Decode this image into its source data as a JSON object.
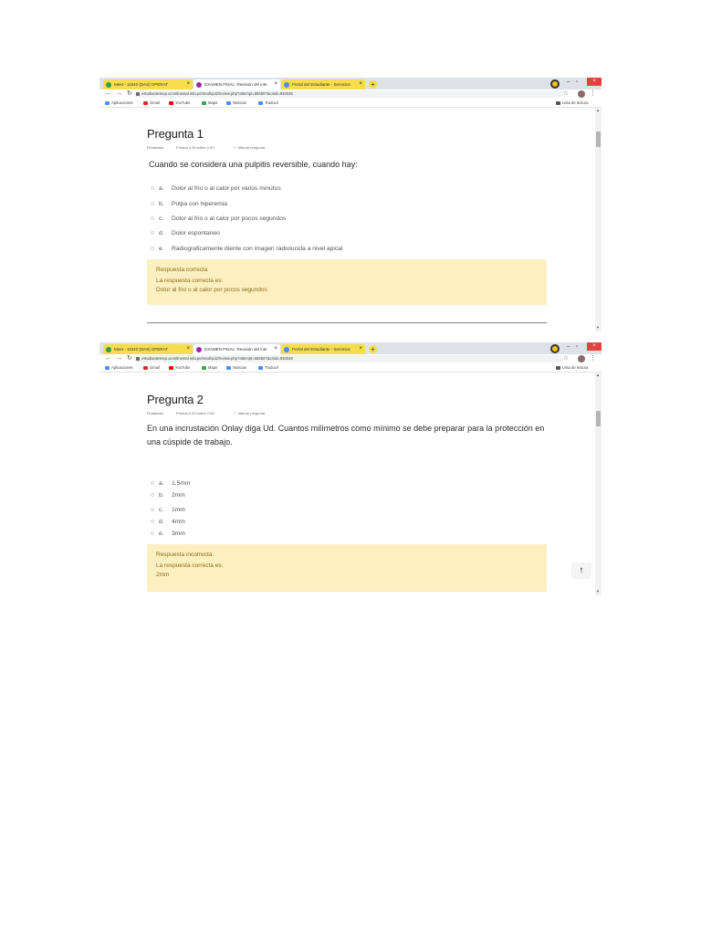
{
  "screenshots": [
    {
      "browser": {
        "tabs": [
          {
            "label": "Meet - 11640 (DAS) OPERAT",
            "color": "#2e9e4f"
          },
          {
            "label": "EXAMEN FINAL: Revisión del inte",
            "color": "#9c27b0"
          },
          {
            "label": "Portal del Estudiante - Servicios",
            "color": "#4a8df5"
          }
        ],
        "new_tab_label": "+",
        "address": "estudiantessvp.ucontinental.edu.pe/mod/quiz/review.php?attempt=556507&cmid=830048",
        "bookmarks": [
          "Aplicaciones",
          "Gmail",
          "YouTube",
          "Maps",
          "Noticias",
          "Traducir"
        ],
        "reading_list": "Lista de lectura"
      },
      "question": {
        "title": "Pregunta 1",
        "status": "Finalizado",
        "score": "Puntúa 2,00 sobre 2,00",
        "flag": "Marcar pregunta",
        "text": "Cuando se considera una pulpitis reversible, cuando hay:",
        "options": [
          {
            "letter": "a.",
            "text": "Dolor al frio o al calor por varios minutos"
          },
          {
            "letter": "b.",
            "text": "Pulpa con hiperemia"
          },
          {
            "letter": "c.",
            "text": "Dolor al frio o al calor por pocos segundos"
          },
          {
            "letter": "d.",
            "text": "Dolor espontaneo"
          },
          {
            "letter": "e.",
            "text": "Radiograficamente diente con imagen radiolucida a nivel apical"
          }
        ],
        "feedback": {
          "result": "Respuesta correcta",
          "answer_label": "La respuesta correcta es:",
          "answer": "Dolor al frio o al calor por pocos segundos"
        }
      }
    },
    {
      "browser": {
        "tabs": [
          {
            "label": "Meet - 11640 (DAS) OPERAT",
            "color": "#2e9e4f"
          },
          {
            "label": "EXAMEN FINAL: Revisión del inte",
            "color": "#9c27b0"
          },
          {
            "label": "Portal del Estudiante - Servicios",
            "color": "#4a8df5"
          }
        ],
        "new_tab_label": "+",
        "address": "estudiantessvp.ucontinental.edu.pe/mod/quiz/review.php?attempt=556507&cmid=830048",
        "bookmarks": [
          "Aplicaciones",
          "Gmail",
          "YouTube",
          "Maps",
          "Noticias",
          "Traducir"
        ],
        "reading_list": "Lista de lectura"
      },
      "question": {
        "title": "Pregunta 2",
        "status": "Finalizado",
        "score": "Puntúa 0,00 sobre 2,00",
        "flag": "Marcar pregunta",
        "text": "En una incrustación Onlay diga Ud. Cuantos milímetros como mínimo se debe preparar para la protección en una cúspide de trabajo.",
        "options": [
          {
            "letter": "a.",
            "text": "1.5mm"
          },
          {
            "letter": "b.",
            "text": "2mm"
          },
          {
            "letter": "c.",
            "text": "1mm"
          },
          {
            "letter": "d.",
            "text": "4mm"
          },
          {
            "letter": "e.",
            "text": "3mm"
          }
        ],
        "feedback": {
          "result": "Respuesta incorrecta.",
          "answer_label": "La respuesta correcta es:",
          "answer": "2mm"
        }
      }
    }
  ],
  "colors": {
    "feedback_bg": "#fcefc0",
    "feedback_text": "#8a6d1d",
    "yellow_tab": "#f6dd4c"
  },
  "icons": {
    "back": "arrow-left-icon",
    "forward": "arrow-right-icon",
    "reload": "reload-icon",
    "lock": "lock-icon",
    "star": "star-icon",
    "flag": "flag-icon",
    "to_top": "arrow-up-icon"
  }
}
